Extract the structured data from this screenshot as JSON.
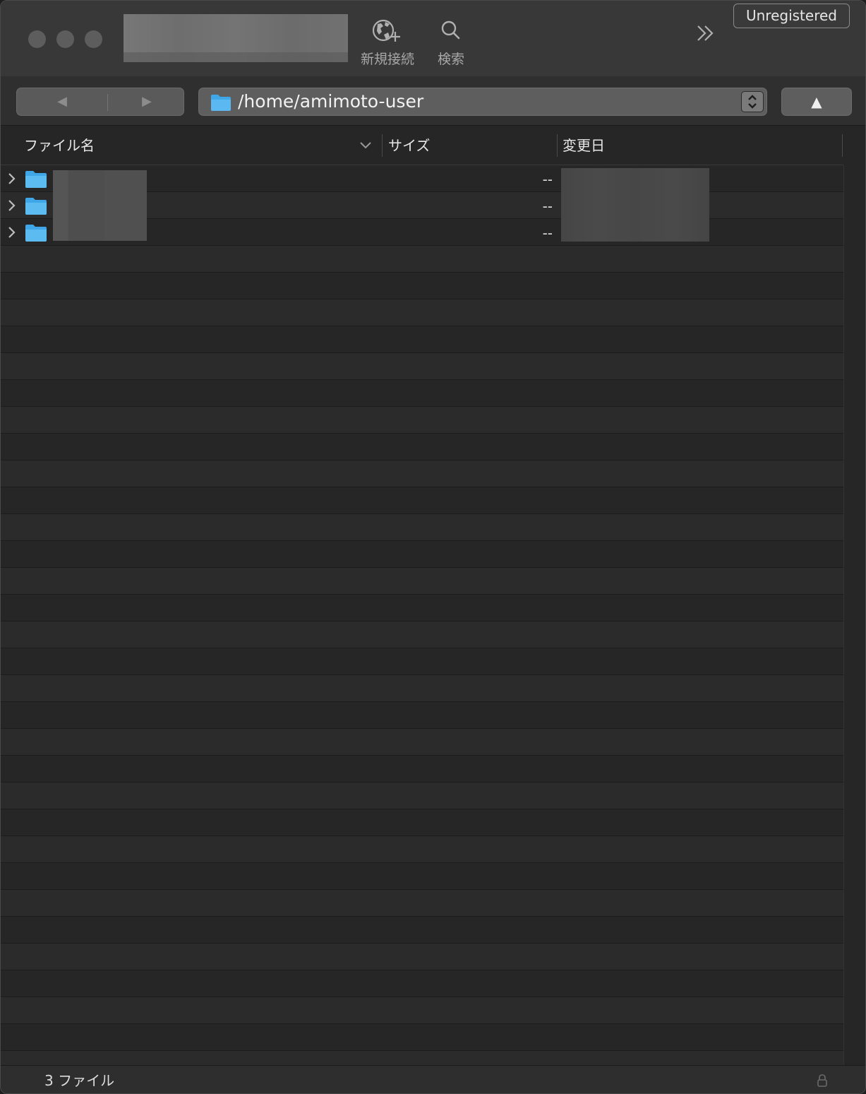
{
  "toolbar": {
    "new_connection_label": "新規接続",
    "search_label": "検索",
    "unregistered_label": "Unregistered"
  },
  "pathbar": {
    "back_glyph": "◀",
    "forward_glyph": "▶",
    "path": "/home/amimoto-user",
    "up_glyph": "▲"
  },
  "columns": {
    "name": "ファイル名",
    "size": "サイズ",
    "modified": "変更日"
  },
  "files": [
    {
      "size": "--"
    },
    {
      "size": "--"
    },
    {
      "size": "--"
    }
  ],
  "footer": {
    "status": "3 ファイル"
  },
  "colors": {
    "folder": "#3fa6e8",
    "background": "#262626",
    "titlebar": "#383838"
  }
}
